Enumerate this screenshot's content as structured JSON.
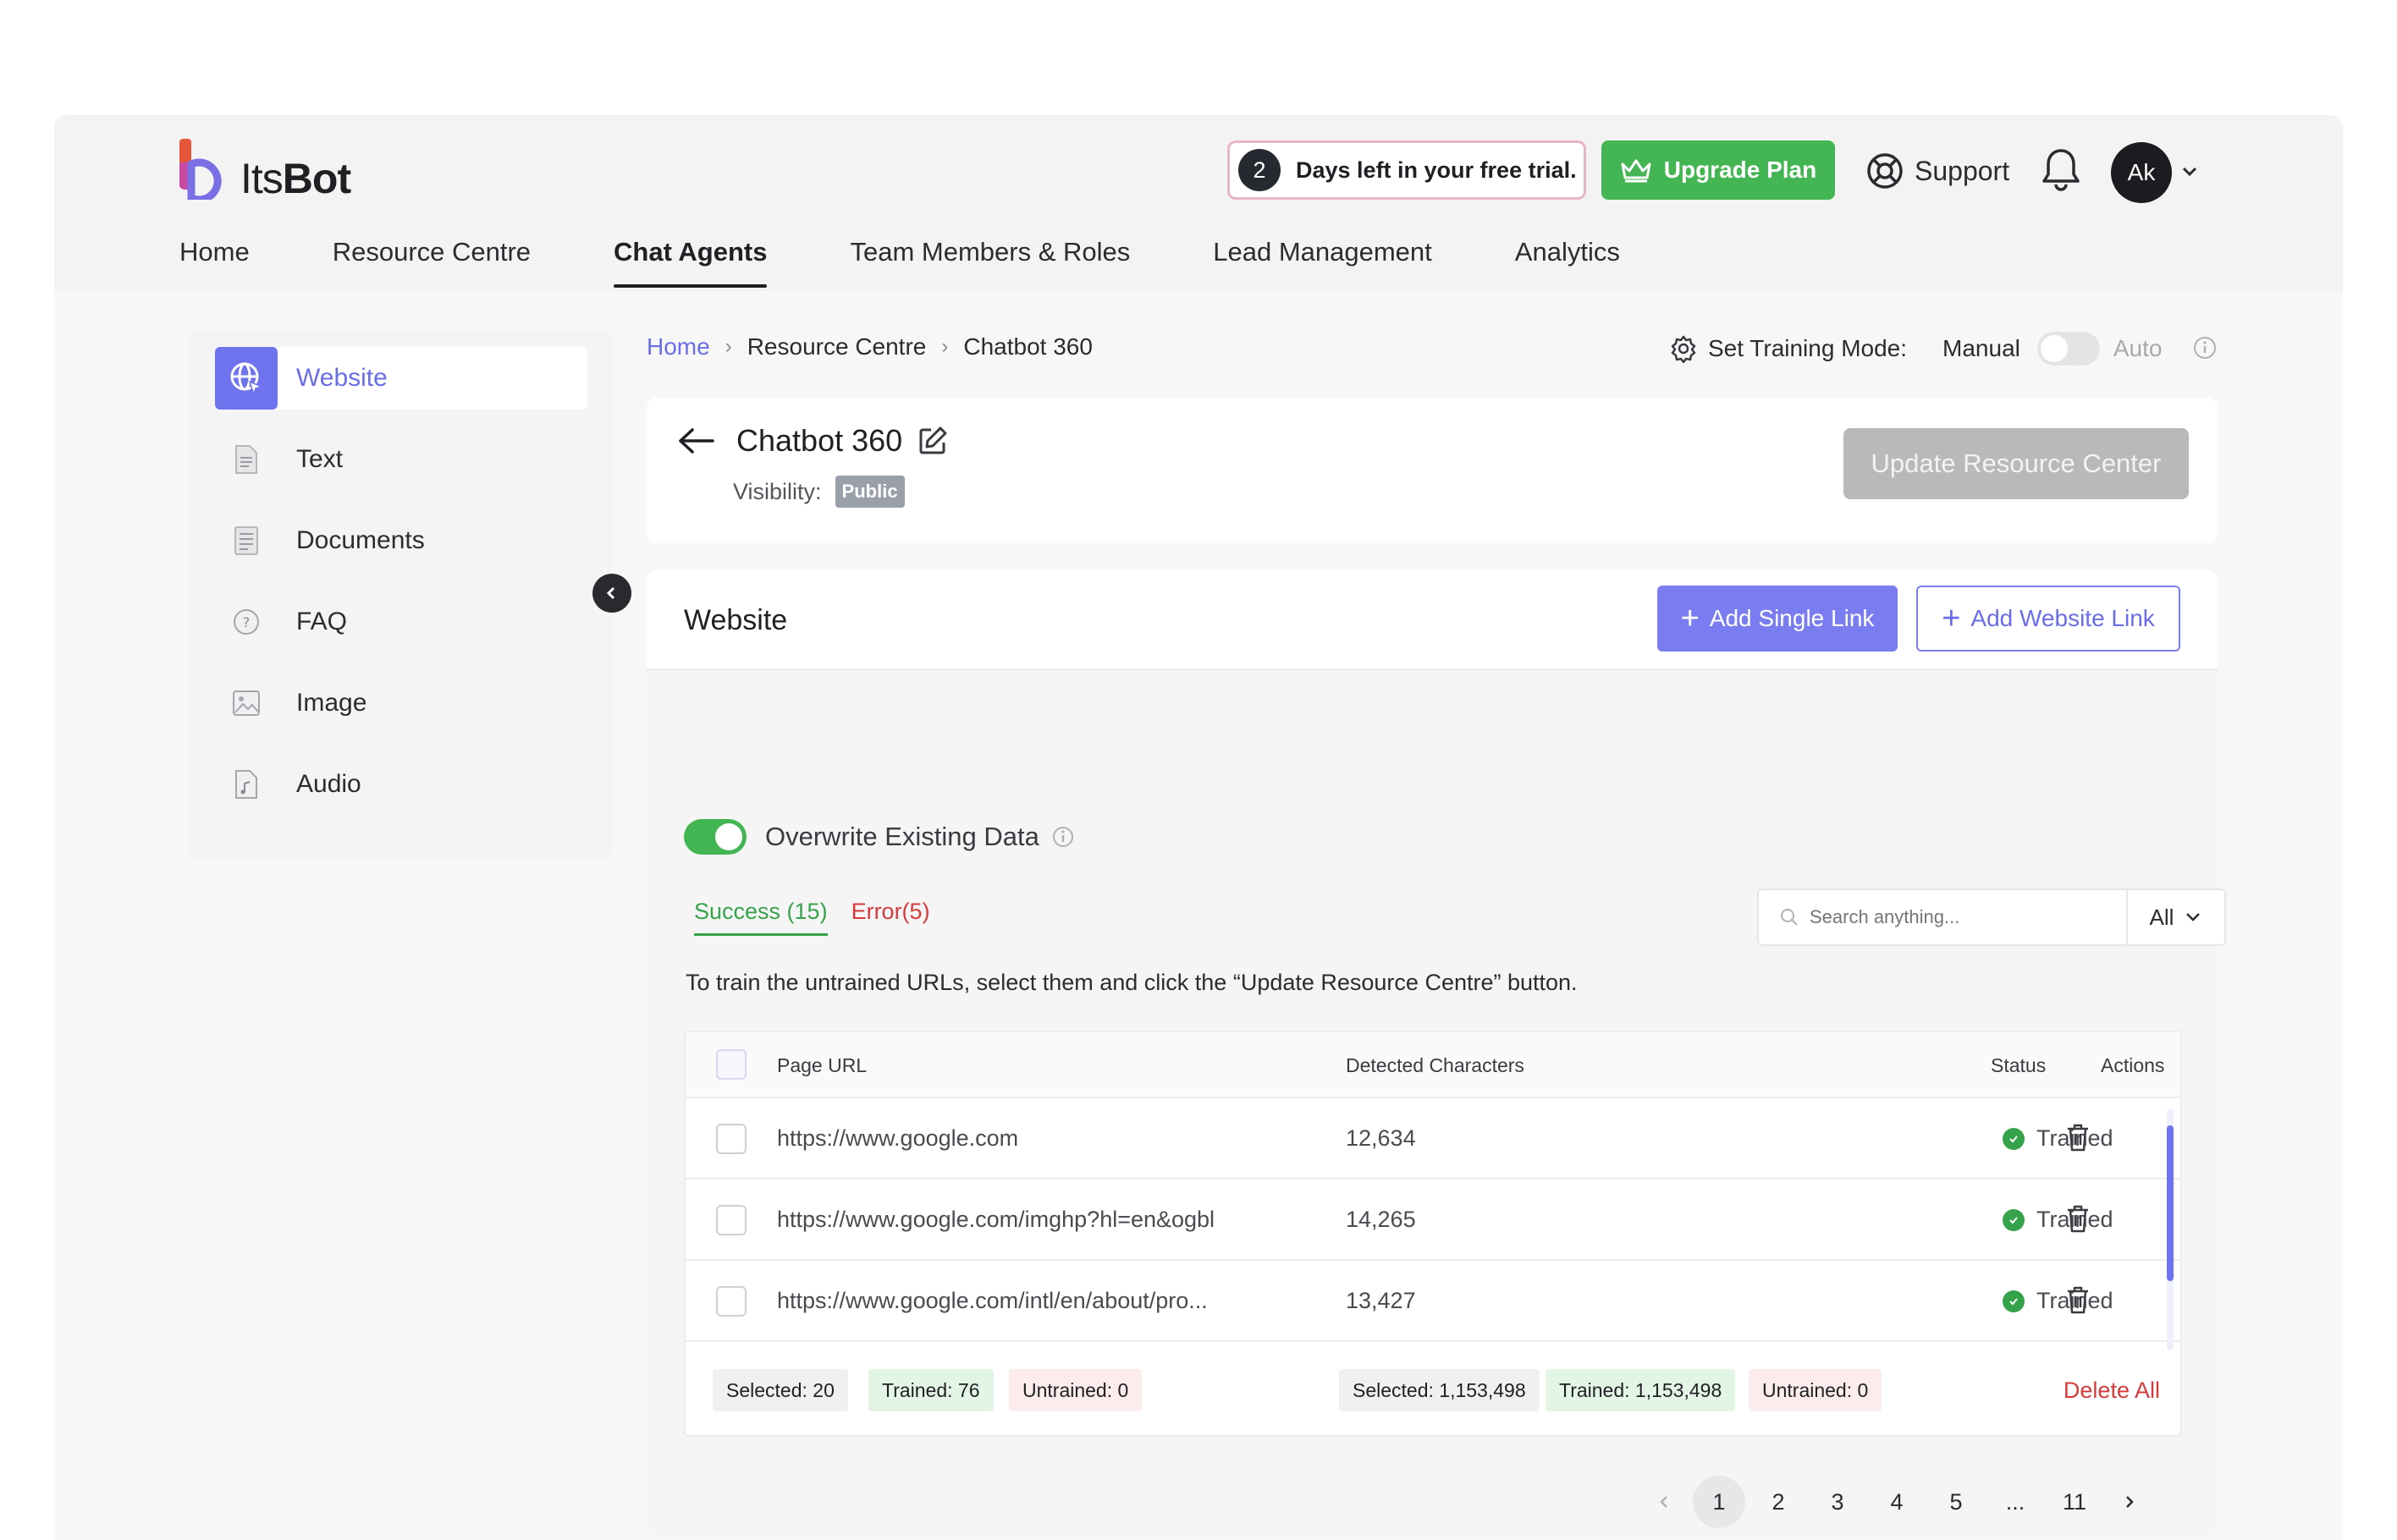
{
  "app": {
    "logo_text_regular": "Its",
    "logo_text_bold": "Bot"
  },
  "header": {
    "trial_days": "2",
    "trial_text": "Days left in your free trial.",
    "upgrade_label": "Upgrade Plan",
    "support_label": "Support",
    "avatar_initials": "Ak"
  },
  "nav": {
    "items": [
      {
        "label": "Home"
      },
      {
        "label": "Resource Centre"
      },
      {
        "label": "Chat Agents",
        "active": true
      },
      {
        "label": "Team Members & Roles"
      },
      {
        "label": "Lead Management"
      },
      {
        "label": "Analytics"
      }
    ]
  },
  "sidebar": {
    "items": [
      {
        "label": "Website",
        "icon": "globe-icon",
        "active": true
      },
      {
        "label": "Text",
        "icon": "text-file-icon"
      },
      {
        "label": "Documents",
        "icon": "document-icon"
      },
      {
        "label": "FAQ",
        "icon": "faq-icon"
      },
      {
        "label": "Image",
        "icon": "image-icon"
      },
      {
        "label": "Audio",
        "icon": "audio-file-icon"
      }
    ]
  },
  "breadcrumb": {
    "items": [
      "Home",
      "Resource Centre",
      "Chatbot 360"
    ]
  },
  "training": {
    "label": "Set Training Mode:",
    "manual": "Manual",
    "auto": "Auto"
  },
  "bot": {
    "title": "Chatbot 360",
    "visibility_label": "Visibility:",
    "visibility_value": "Public",
    "update_label": "Update Resource Center"
  },
  "website": {
    "title": "Website",
    "add_single_label": "Add Single Link",
    "add_website_label": "Add Website Link",
    "overwrite_label": "Overwrite Existing Data",
    "tab_success": "Success (15)",
    "tab_error": "Error(5)",
    "search_placeholder": "Search anything...",
    "filter_value": "All",
    "hint": "To train the untrained URLs, select them and click the “Update Resource Centre” button."
  },
  "table": {
    "columns": {
      "url": "Page URL",
      "chars": "Detected Characters",
      "status": "Status",
      "actions": "Actions"
    },
    "rows": [
      {
        "url": "https://www.google.com",
        "chars": "12,634",
        "status": "Trained"
      },
      {
        "url": "https://www.google.com/imghp?hl=en&ogbl",
        "chars": "14,265",
        "status": "Trained"
      },
      {
        "url": "https://www.google.com/intl/en/about/pro...",
        "chars": "13,427",
        "status": "Trained"
      }
    ],
    "footer": {
      "url_selected": "Selected: 20",
      "url_trained": "Trained: 76",
      "url_untrained": "Untrained: 0",
      "chars_selected": "Selected: 1,153,498",
      "chars_trained": "Trained: 1,153,498",
      "chars_untrained": "Untrained: 0",
      "delete_all": "Delete All"
    }
  },
  "pagination": {
    "pages": [
      "1",
      "2",
      "3",
      "4",
      "5",
      "...",
      "11"
    ],
    "current": "1"
  },
  "colors": {
    "accent": "#6f73ee",
    "success": "#43b653",
    "error": "#d63a3a"
  }
}
